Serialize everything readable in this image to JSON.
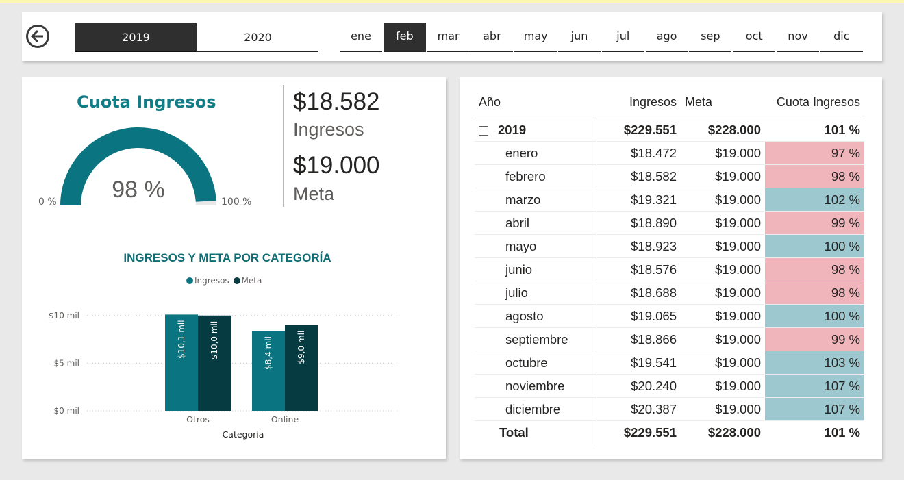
{
  "colors": {
    "accent_teal": "#117d87",
    "bar_ingresos": "#0a7580",
    "bar_meta": "#073b42",
    "below_target": "#f0b5bb",
    "above_target": "#9dc8cf"
  },
  "slicer": {
    "back_icon": "arrow-left-circle-icon",
    "years": [
      {
        "label": "2019",
        "selected": true
      },
      {
        "label": "2020",
        "selected": false
      }
    ],
    "months": [
      {
        "label": "ene",
        "selected": false
      },
      {
        "label": "feb",
        "selected": true
      },
      {
        "label": "mar",
        "selected": false
      },
      {
        "label": "abr",
        "selected": false
      },
      {
        "label": "may",
        "selected": false
      },
      {
        "label": "jun",
        "selected": false
      },
      {
        "label": "jul",
        "selected": false
      },
      {
        "label": "ago",
        "selected": false
      },
      {
        "label": "sep",
        "selected": false
      },
      {
        "label": "oct",
        "selected": false
      },
      {
        "label": "nov",
        "selected": false
      },
      {
        "label": "dic",
        "selected": false
      }
    ]
  },
  "gauge": {
    "title": "Cuota Ingresos",
    "value_label": "98 %",
    "value_fraction": 0.98,
    "min_label": "0 %",
    "max_label": "100 %"
  },
  "kpi": {
    "ingresos_value": "$18.582",
    "ingresos_label": "Ingresos",
    "meta_value": "$19.000",
    "meta_label": "Meta"
  },
  "chart_data": {
    "type": "bar",
    "title": "INGRESOS Y META POR CATEGORÍA",
    "xlabel": "Categoría",
    "ylabel": "",
    "categories": [
      "Otros",
      "Online"
    ],
    "series": [
      {
        "name": "Ingresos",
        "values": [
          10.1,
          8.4
        ],
        "labels": [
          "$10,1 mil",
          "$8,4 mil"
        ]
      },
      {
        "name": "Meta",
        "values": [
          10.0,
          9.0
        ],
        "labels": [
          "$10,0 mil",
          "$9,0 mil"
        ]
      }
    ],
    "yticks": [
      0,
      5,
      10
    ],
    "ytick_labels": [
      "$0 mil",
      "$5 mil",
      "$10 mil"
    ],
    "ylim": [
      0,
      10.2
    ],
    "grid": true,
    "legend_position": "top-center"
  },
  "table": {
    "headers": [
      "Año",
      "Ingresos",
      "Meta",
      "Cuota Ingresos"
    ],
    "year_row": {
      "label": "2019",
      "ingresos": "$229.551",
      "meta": "$228.000",
      "cuota": "101 %"
    },
    "rows": [
      {
        "label": "enero",
        "ingresos": "$18.472",
        "meta": "$19.000",
        "cuota": "97 %",
        "status": "low"
      },
      {
        "label": "febrero",
        "ingresos": "$18.582",
        "meta": "$19.000",
        "cuota": "98 %",
        "status": "low"
      },
      {
        "label": "marzo",
        "ingresos": "$19.321",
        "meta": "$19.000",
        "cuota": "102 %",
        "status": "high"
      },
      {
        "label": "abril",
        "ingresos": "$18.890",
        "meta": "$19.000",
        "cuota": "99 %",
        "status": "low"
      },
      {
        "label": "mayo",
        "ingresos": "$18.923",
        "meta": "$19.000",
        "cuota": "100 %",
        "status": "high"
      },
      {
        "label": "junio",
        "ingresos": "$18.576",
        "meta": "$19.000",
        "cuota": "98 %",
        "status": "low"
      },
      {
        "label": "julio",
        "ingresos": "$18.688",
        "meta": "$19.000",
        "cuota": "98 %",
        "status": "low"
      },
      {
        "label": "agosto",
        "ingresos": "$19.065",
        "meta": "$19.000",
        "cuota": "100 %",
        "status": "high"
      },
      {
        "label": "septiembre",
        "ingresos": "$18.866",
        "meta": "$19.000",
        "cuota": "99 %",
        "status": "low"
      },
      {
        "label": "octubre",
        "ingresos": "$19.541",
        "meta": "$19.000",
        "cuota": "103 %",
        "status": "high"
      },
      {
        "label": "noviembre",
        "ingresos": "$20.240",
        "meta": "$19.000",
        "cuota": "107 %",
        "status": "high"
      },
      {
        "label": "diciembre",
        "ingresos": "$20.387",
        "meta": "$19.000",
        "cuota": "107 %",
        "status": "high"
      }
    ],
    "total_row": {
      "label": "Total",
      "ingresos": "$229.551",
      "meta": "$228.000",
      "cuota": "101 %"
    }
  }
}
